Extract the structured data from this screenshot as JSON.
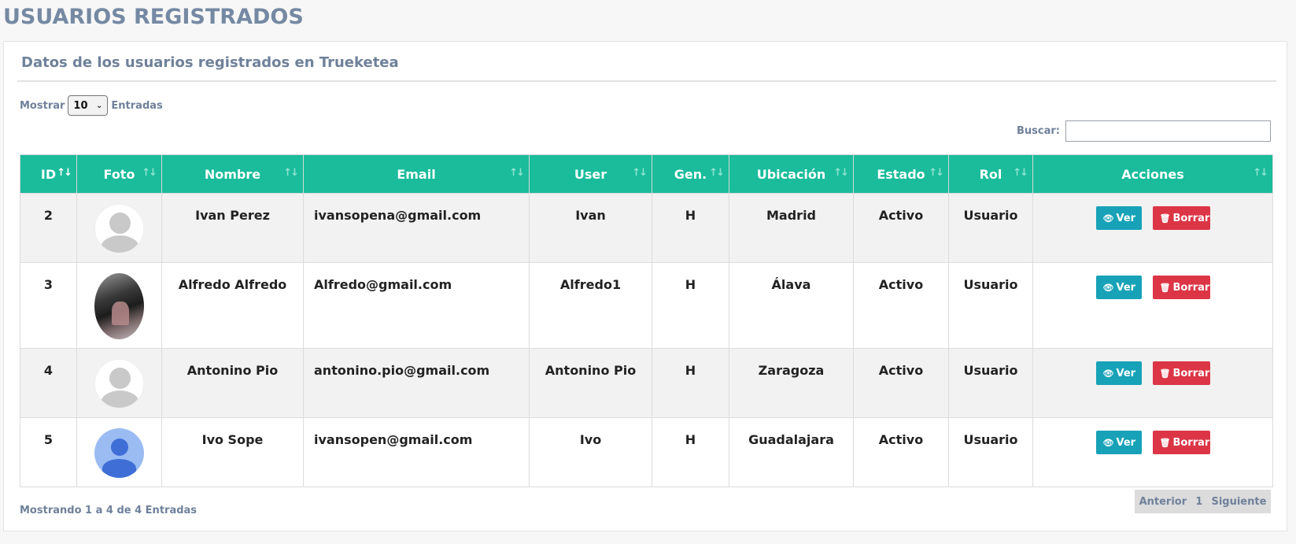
{
  "page_title": "USUARIOS REGISTRADOS",
  "card_title": "Datos de los usuarios registrados en Trueketea",
  "length": {
    "prefix": "Mostrar",
    "value": "10",
    "suffix": "Entradas"
  },
  "search": {
    "label": "Buscar:",
    "value": "",
    "placeholder": ""
  },
  "columns": [
    "ID",
    "Foto",
    "Nombre",
    "Email",
    "User",
    "Gen.",
    "Ubicación",
    "Estado",
    "Rol",
    "Acciones"
  ],
  "rows": [
    {
      "id": "2",
      "foto": "default-avatar",
      "nombre": "Ivan Perez",
      "email": "ivansopena@gmail.com",
      "user": "Ivan",
      "gen": "H",
      "ubicacion": "Madrid",
      "estado": "Activo",
      "rol": "Usuario"
    },
    {
      "id": "3",
      "foto": "photo-avatar",
      "nombre": "Alfredo Alfredo",
      "email": "Alfredo@gmail.com",
      "user": "Alfredo1",
      "gen": "H",
      "ubicacion": "Álava",
      "estado": "Activo",
      "rol": "Usuario"
    },
    {
      "id": "4",
      "foto": "default-avatar",
      "nombre": "Antonino Pio",
      "email": "antonino.pio@gmail.com",
      "user": "Antonino Pio",
      "gen": "H",
      "ubicacion": "Zaragoza",
      "estado": "Activo",
      "rol": "Usuario"
    },
    {
      "id": "5",
      "foto": "blue-avatar",
      "nombre": "Ivo Sope",
      "email": "ivansopen@gmail.com",
      "user": "Ivo",
      "gen": "H",
      "ubicacion": "Guadalajara",
      "estado": "Activo",
      "rol": "Usuario"
    }
  ],
  "actions": {
    "view_label": "Ver",
    "delete_label": "Borrar",
    "view_icon": "eye-icon",
    "delete_icon": "trash-icon"
  },
  "info": "Mostrando 1 a 4 de 4 Entradas",
  "pagination": {
    "prev": "Anterior",
    "page": "1",
    "next": "Siguiente"
  },
  "colors": {
    "header": "#1abc9c",
    "title": "#7589a3",
    "ver": "#17a2b8",
    "borrar": "#dc3545"
  }
}
